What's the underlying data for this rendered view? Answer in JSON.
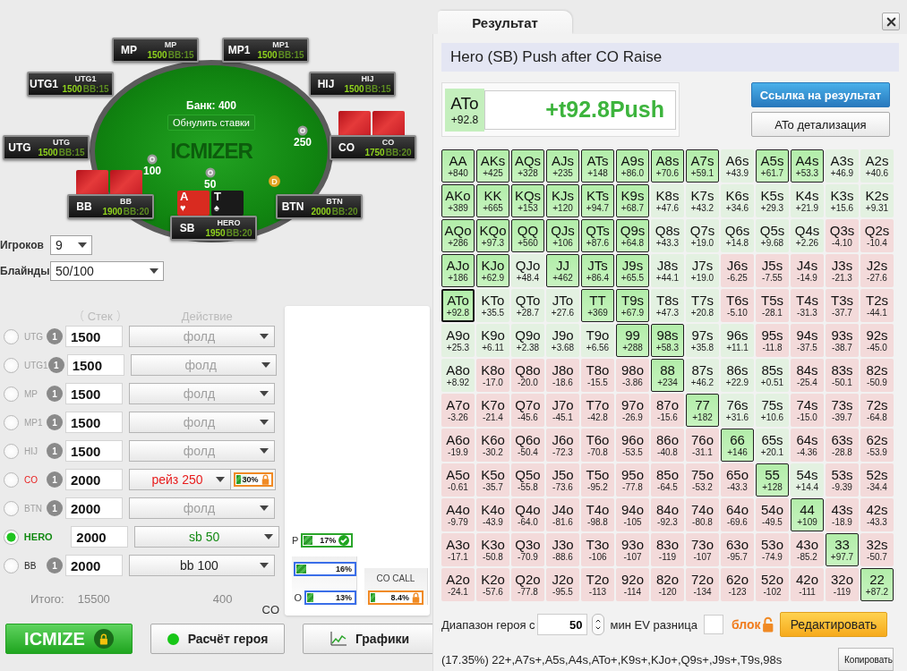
{
  "table": {
    "pot": "Банк: 400",
    "reset_button": "Обнулить ставки",
    "logo": "ICMIZER",
    "dealer": "D",
    "seats": [
      {
        "position": "MP",
        "name": "MP",
        "stack": "1500",
        "bb": "BB:15",
        "cards_face_down": false
      },
      {
        "position": "MP1",
        "name": "MP1",
        "stack": "1500",
        "bb": "BB:15",
        "cards_face_down": false
      },
      {
        "position": "UTG1",
        "name": "UTG1",
        "stack": "1500",
        "bb": "BB:15",
        "cards_face_down": false
      },
      {
        "position": "HIJ",
        "name": "HIJ",
        "stack": "1500",
        "bb": "BB:15",
        "cards_face_down": false
      },
      {
        "position": "UTG",
        "name": "UTG",
        "stack": "1500",
        "bb": "BB:15",
        "cards_face_down": false
      },
      {
        "position": "CO",
        "name": "CO",
        "stack": "1750",
        "bb": "BB:20",
        "cards_face_down": true
      },
      {
        "position": "BB",
        "name": "BB",
        "stack": "1900",
        "bb": "BB:20",
        "cards_face_down": true
      },
      {
        "position": "BTN",
        "name": "BTN",
        "stack": "2000",
        "bb": "BB:20",
        "cards_face_down": false
      },
      {
        "position": "SB",
        "name": "HERO",
        "stack": "1950",
        "bb": "BB:20",
        "cards_face_down": false
      }
    ],
    "hero_cards": [
      {
        "rank": "A",
        "suit": "♥",
        "color": "#d92b20"
      },
      {
        "rank": "T",
        "suit": "♠",
        "color": "#1a1a1a"
      }
    ],
    "bets": [
      {
        "amount": "250"
      },
      {
        "amount": "100"
      },
      {
        "amount": "50"
      }
    ]
  },
  "settings": {
    "players": {
      "label": "Игроков",
      "value": "9"
    },
    "blinds": {
      "label": "Блайнды",
      "value": "50/100"
    }
  },
  "players_table": {
    "headers": [
      "Стек",
      "Действие"
    ],
    "rows": [
      {
        "position": "UTG",
        "selected": false,
        "kind": "fold",
        "badge": "1",
        "stack": "1500",
        "action": "фолд"
      },
      {
        "position": "UTG1",
        "selected": false,
        "kind": "fold",
        "badge": "1",
        "stack": "1500",
        "action": "фолд"
      },
      {
        "position": "MP",
        "selected": false,
        "kind": "fold",
        "badge": "1",
        "stack": "1500",
        "action": "фолд"
      },
      {
        "position": "MP1",
        "selected": false,
        "kind": "fold",
        "badge": "1",
        "stack": "1500",
        "action": "фолд"
      },
      {
        "position": "HIJ",
        "selected": false,
        "kind": "fold",
        "badge": "1",
        "stack": "1500",
        "action": "фолд"
      },
      {
        "position": "CO",
        "selected": false,
        "kind": "raise",
        "badge": "1",
        "stack": "2000",
        "action": "рейз 250",
        "range": {
          "value": "30%",
          "level": 0.3,
          "locked": true
        }
      },
      {
        "position": "BTN",
        "selected": false,
        "kind": "fold",
        "badge": "1",
        "stack": "2000",
        "action": "фолд"
      },
      {
        "position": "HERO",
        "selected": true,
        "kind": "hero",
        "stack": "2000",
        "action": "sb 50"
      },
      {
        "position": "BB",
        "selected": false,
        "kind": "blind",
        "badge": "1",
        "stack": "2000",
        "action": "bb 100"
      }
    ],
    "totals": {
      "label": "Итого:",
      "stack": "15500",
      "action": "400"
    }
  },
  "range_panel": {
    "side_label": "CO",
    "ranges": [
      {
        "prefix": "P",
        "value": "17%",
        "level": 0.17,
        "kind": "confirmed"
      },
      {
        "value": "16%",
        "level": 0.16,
        "kind": "plain"
      },
      {
        "prefix": "O",
        "value": "13%",
        "level": 0.13,
        "kind": "plain"
      }
    ],
    "call": {
      "title": "CO CALL",
      "value": "8.4%",
      "level": 0.084,
      "locked": true
    }
  },
  "actions": [
    {
      "label": "ICMIZE",
      "kind": "primary",
      "locked": true
    },
    {
      "label": "Расчёт героя",
      "kind": "status"
    },
    {
      "label": "Графики",
      "kind": "chart"
    }
  ],
  "result": {
    "tab": "Результат",
    "title": "Hero (SB) Push after CO Raise",
    "hand": {
      "name": "ATo",
      "ev": "+92.8"
    },
    "verdict": "+t92.8Push",
    "buttons": [
      {
        "label": "Ссылка на результат",
        "kind": "primary"
      },
      {
        "label": "ATo детализация",
        "kind": "default"
      }
    ],
    "grid": [
      [
        {
          "hand": "AA",
          "ev": "+840",
          "in_range": true,
          "selected": false
        },
        {
          "hand": "AKs",
          "ev": "+425",
          "in_range": true,
          "selected": false
        },
        {
          "hand": "AQs",
          "ev": "+328",
          "in_range": true,
          "selected": false
        },
        {
          "hand": "AJs",
          "ev": "+235",
          "in_range": true,
          "selected": false
        },
        {
          "hand": "ATs",
          "ev": "+148",
          "in_range": true,
          "selected": false
        },
        {
          "hand": "A9s",
          "ev": "+86.0",
          "in_range": true,
          "selected": false
        },
        {
          "hand": "A8s",
          "ev": "+70.6",
          "in_range": true,
          "selected": false
        },
        {
          "hand": "A7s",
          "ev": "+59.1",
          "in_range": true,
          "selected": false
        },
        {
          "hand": "A6s",
          "ev": "+43.9",
          "in_range": false,
          "selected": false
        },
        {
          "hand": "A5s",
          "ev": "+61.7",
          "in_range": true,
          "selected": false
        },
        {
          "hand": "A4s",
          "ev": "+53.3",
          "in_range": true,
          "selected": false
        },
        {
          "hand": "A3s",
          "ev": "+46.9",
          "in_range": false,
          "selected": false
        },
        {
          "hand": "A2s",
          "ev": "+40.6",
          "in_range": false,
          "selected": false
        }
      ],
      [
        {
          "hand": "AKo",
          "ev": "+389",
          "in_range": true,
          "selected": false
        },
        {
          "hand": "KK",
          "ev": "+665",
          "in_range": true,
          "selected": false
        },
        {
          "hand": "KQs",
          "ev": "+153",
          "in_range": true,
          "selected": false
        },
        {
          "hand": "KJs",
          "ev": "+120",
          "in_range": true,
          "selected": false
        },
        {
          "hand": "KTs",
          "ev": "+94.7",
          "in_range": true,
          "selected": false
        },
        {
          "hand": "K9s",
          "ev": "+68.7",
          "in_range": true,
          "selected": false
        },
        {
          "hand": "K8s",
          "ev": "+47.6",
          "in_range": false,
          "selected": false
        },
        {
          "hand": "K7s",
          "ev": "+43.2",
          "in_range": false,
          "selected": false
        },
        {
          "hand": "K6s",
          "ev": "+34.6",
          "in_range": false,
          "selected": false
        },
        {
          "hand": "K5s",
          "ev": "+29.3",
          "in_range": false,
          "selected": false
        },
        {
          "hand": "K4s",
          "ev": "+21.9",
          "in_range": false,
          "selected": false
        },
        {
          "hand": "K3s",
          "ev": "+15.6",
          "in_range": false,
          "selected": false
        },
        {
          "hand": "K2s",
          "ev": "+9.31",
          "in_range": false,
          "selected": false
        }
      ],
      [
        {
          "hand": "AQo",
          "ev": "+286",
          "in_range": true,
          "selected": false
        },
        {
          "hand": "KQo",
          "ev": "+97.3",
          "in_range": true,
          "selected": false
        },
        {
          "hand": "QQ",
          "ev": "+560",
          "in_range": true,
          "selected": false
        },
        {
          "hand": "QJs",
          "ev": "+106",
          "in_range": true,
          "selected": false
        },
        {
          "hand": "QTs",
          "ev": "+87.6",
          "in_range": true,
          "selected": false
        },
        {
          "hand": "Q9s",
          "ev": "+64.8",
          "in_range": true,
          "selected": false
        },
        {
          "hand": "Q8s",
          "ev": "+43.3",
          "in_range": false,
          "selected": false
        },
        {
          "hand": "Q7s",
          "ev": "+19.0",
          "in_range": false,
          "selected": false
        },
        {
          "hand": "Q6s",
          "ev": "+14.8",
          "in_range": false,
          "selected": false
        },
        {
          "hand": "Q5s",
          "ev": "+9.68",
          "in_range": false,
          "selected": false
        },
        {
          "hand": "Q4s",
          "ev": "+2.26",
          "in_range": false,
          "selected": false
        },
        {
          "hand": "Q3s",
          "ev": "-4.10",
          "in_range": false,
          "selected": false
        },
        {
          "hand": "Q2s",
          "ev": "-10.4",
          "in_range": false,
          "selected": false
        }
      ],
      [
        {
          "hand": "AJo",
          "ev": "+186",
          "in_range": true,
          "selected": false
        },
        {
          "hand": "KJo",
          "ev": "+62.9",
          "in_range": true,
          "selected": false
        },
        {
          "hand": "QJo",
          "ev": "+48.4",
          "in_range": false,
          "selected": false
        },
        {
          "hand": "JJ",
          "ev": "+462",
          "in_range": true,
          "selected": false
        },
        {
          "hand": "JTs",
          "ev": "+86.4",
          "in_range": true,
          "selected": false
        },
        {
          "hand": "J9s",
          "ev": "+65.5",
          "in_range": true,
          "selected": false
        },
        {
          "hand": "J8s",
          "ev": "+44.1",
          "in_range": false,
          "selected": false
        },
        {
          "hand": "J7s",
          "ev": "+19.0",
          "in_range": false,
          "selected": false
        },
        {
          "hand": "J6s",
          "ev": "-6.25",
          "in_range": false,
          "selected": false
        },
        {
          "hand": "J5s",
          "ev": "-7.55",
          "in_range": false,
          "selected": false
        },
        {
          "hand": "J4s",
          "ev": "-14.9",
          "in_range": false,
          "selected": false
        },
        {
          "hand": "J3s",
          "ev": "-21.3",
          "in_range": false,
          "selected": false
        },
        {
          "hand": "J2s",
          "ev": "-27.6",
          "in_range": false,
          "selected": false
        }
      ],
      [
        {
          "hand": "ATo",
          "ev": "+92.8",
          "in_range": true,
          "selected": true
        },
        {
          "hand": "KTo",
          "ev": "+35.5",
          "in_range": false,
          "selected": false
        },
        {
          "hand": "QTo",
          "ev": "+28.7",
          "in_range": false,
          "selected": false
        },
        {
          "hand": "JTo",
          "ev": "+27.6",
          "in_range": false,
          "selected": false
        },
        {
          "hand": "TT",
          "ev": "+369",
          "in_range": true,
          "selected": false
        },
        {
          "hand": "T9s",
          "ev": "+67.9",
          "in_range": true,
          "selected": false
        },
        {
          "hand": "T8s",
          "ev": "+47.3",
          "in_range": false,
          "selected": false
        },
        {
          "hand": "T7s",
          "ev": "+20.8",
          "in_range": false,
          "selected": false
        },
        {
          "hand": "T6s",
          "ev": "-5.10",
          "in_range": false,
          "selected": false
        },
        {
          "hand": "T5s",
          "ev": "-28.1",
          "in_range": false,
          "selected": false
        },
        {
          "hand": "T4s",
          "ev": "-31.3",
          "in_range": false,
          "selected": false
        },
        {
          "hand": "T3s",
          "ev": "-37.7",
          "in_range": false,
          "selected": false
        },
        {
          "hand": "T2s",
          "ev": "-44.1",
          "in_range": false,
          "selected": false
        }
      ],
      [
        {
          "hand": "A9o",
          "ev": "+25.3",
          "in_range": false,
          "selected": false
        },
        {
          "hand": "K9o",
          "ev": "+6.11",
          "in_range": false,
          "selected": false
        },
        {
          "hand": "Q9o",
          "ev": "+2.38",
          "in_range": false,
          "selected": false
        },
        {
          "hand": "J9o",
          "ev": "+3.68",
          "in_range": false,
          "selected": false
        },
        {
          "hand": "T9o",
          "ev": "+6.56",
          "in_range": false,
          "selected": false
        },
        {
          "hand": "99",
          "ev": "+288",
          "in_range": true,
          "selected": false
        },
        {
          "hand": "98s",
          "ev": "+58.3",
          "in_range": true,
          "selected": false
        },
        {
          "hand": "97s",
          "ev": "+35.8",
          "in_range": false,
          "selected": false
        },
        {
          "hand": "96s",
          "ev": "+11.1",
          "in_range": false,
          "selected": false
        },
        {
          "hand": "95s",
          "ev": "-11.8",
          "in_range": false,
          "selected": false
        },
        {
          "hand": "94s",
          "ev": "-37.5",
          "in_range": false,
          "selected": false
        },
        {
          "hand": "93s",
          "ev": "-38.7",
          "in_range": false,
          "selected": false
        },
        {
          "hand": "92s",
          "ev": "-45.0",
          "in_range": false,
          "selected": false
        }
      ],
      [
        {
          "hand": "A8o",
          "ev": "+8.92",
          "in_range": false,
          "selected": false
        },
        {
          "hand": "K8o",
          "ev": "-17.0",
          "in_range": false,
          "selected": false
        },
        {
          "hand": "Q8o",
          "ev": "-20.0",
          "in_range": false,
          "selected": false
        },
        {
          "hand": "J8o",
          "ev": "-18.6",
          "in_range": false,
          "selected": false
        },
        {
          "hand": "T8o",
          "ev": "-15.5",
          "in_range": false,
          "selected": false
        },
        {
          "hand": "98o",
          "ev": "-3.86",
          "in_range": false,
          "selected": false
        },
        {
          "hand": "88",
          "ev": "+234",
          "in_range": true,
          "selected": false
        },
        {
          "hand": "87s",
          "ev": "+46.2",
          "in_range": false,
          "selected": false
        },
        {
          "hand": "86s",
          "ev": "+22.9",
          "in_range": false,
          "selected": false
        },
        {
          "hand": "85s",
          "ev": "+0.51",
          "in_range": false,
          "selected": false
        },
        {
          "hand": "84s",
          "ev": "-25.4",
          "in_range": false,
          "selected": false
        },
        {
          "hand": "83s",
          "ev": "-50.1",
          "in_range": false,
          "selected": false
        },
        {
          "hand": "82s",
          "ev": "-50.9",
          "in_range": false,
          "selected": false
        }
      ],
      [
        {
          "hand": "A7o",
          "ev": "-3.26",
          "in_range": false,
          "selected": false
        },
        {
          "hand": "K7o",
          "ev": "-21.4",
          "in_range": false,
          "selected": false
        },
        {
          "hand": "Q7o",
          "ev": "-45.6",
          "in_range": false,
          "selected": false
        },
        {
          "hand": "J7o",
          "ev": "-45.1",
          "in_range": false,
          "selected": false
        },
        {
          "hand": "T7o",
          "ev": "-42.8",
          "in_range": false,
          "selected": false
        },
        {
          "hand": "97o",
          "ev": "-26.9",
          "in_range": false,
          "selected": false
        },
        {
          "hand": "87o",
          "ev": "-15.6",
          "in_range": false,
          "selected": false
        },
        {
          "hand": "77",
          "ev": "+182",
          "in_range": true,
          "selected": false
        },
        {
          "hand": "76s",
          "ev": "+31.6",
          "in_range": false,
          "selected": false
        },
        {
          "hand": "75s",
          "ev": "+10.6",
          "in_range": false,
          "selected": false
        },
        {
          "hand": "74s",
          "ev": "-15.0",
          "in_range": false,
          "selected": false
        },
        {
          "hand": "73s",
          "ev": "-39.7",
          "in_range": false,
          "selected": false
        },
        {
          "hand": "72s",
          "ev": "-64.8",
          "in_range": false,
          "selected": false
        }
      ],
      [
        {
          "hand": "A6o",
          "ev": "-19.9",
          "in_range": false,
          "selected": false
        },
        {
          "hand": "K6o",
          "ev": "-30.2",
          "in_range": false,
          "selected": false
        },
        {
          "hand": "Q6o",
          "ev": "-50.4",
          "in_range": false,
          "selected": false
        },
        {
          "hand": "J6o",
          "ev": "-72.3",
          "in_range": false,
          "selected": false
        },
        {
          "hand": "T6o",
          "ev": "-70.8",
          "in_range": false,
          "selected": false
        },
        {
          "hand": "96o",
          "ev": "-53.5",
          "in_range": false,
          "selected": false
        },
        {
          "hand": "86o",
          "ev": "-40.8",
          "in_range": false,
          "selected": false
        },
        {
          "hand": "76o",
          "ev": "-31.1",
          "in_range": false,
          "selected": false
        },
        {
          "hand": "66",
          "ev": "+146",
          "in_range": true,
          "selected": false
        },
        {
          "hand": "65s",
          "ev": "+20.1",
          "in_range": false,
          "selected": false
        },
        {
          "hand": "64s",
          "ev": "-4.36",
          "in_range": false,
          "selected": false
        },
        {
          "hand": "63s",
          "ev": "-28.8",
          "in_range": false,
          "selected": false
        },
        {
          "hand": "62s",
          "ev": "-53.9",
          "in_range": false,
          "selected": false
        }
      ],
      [
        {
          "hand": "A5o",
          "ev": "-0.61",
          "in_range": false,
          "selected": false
        },
        {
          "hand": "K5o",
          "ev": "-35.7",
          "in_range": false,
          "selected": false
        },
        {
          "hand": "Q5o",
          "ev": "-55.8",
          "in_range": false,
          "selected": false
        },
        {
          "hand": "J5o",
          "ev": "-73.6",
          "in_range": false,
          "selected": false
        },
        {
          "hand": "T5o",
          "ev": "-95.2",
          "in_range": false,
          "selected": false
        },
        {
          "hand": "95o",
          "ev": "-77.8",
          "in_range": false,
          "selected": false
        },
        {
          "hand": "85o",
          "ev": "-64.5",
          "in_range": false,
          "selected": false
        },
        {
          "hand": "75o",
          "ev": "-53.2",
          "in_range": false,
          "selected": false
        },
        {
          "hand": "65o",
          "ev": "-43.3",
          "in_range": false,
          "selected": false
        },
        {
          "hand": "55",
          "ev": "+128",
          "in_range": true,
          "selected": false
        },
        {
          "hand": "54s",
          "ev": "+14.4",
          "in_range": false,
          "selected": false
        },
        {
          "hand": "53s",
          "ev": "-9.39",
          "in_range": false,
          "selected": false
        },
        {
          "hand": "52s",
          "ev": "-34.4",
          "in_range": false,
          "selected": false
        }
      ],
      [
        {
          "hand": "A4o",
          "ev": "-9.79",
          "in_range": false,
          "selected": false
        },
        {
          "hand": "K4o",
          "ev": "-43.9",
          "in_range": false,
          "selected": false
        },
        {
          "hand": "Q4o",
          "ev": "-64.0",
          "in_range": false,
          "selected": false
        },
        {
          "hand": "J4o",
          "ev": "-81.6",
          "in_range": false,
          "selected": false
        },
        {
          "hand": "T4o",
          "ev": "-98.8",
          "in_range": false,
          "selected": false
        },
        {
          "hand": "94o",
          "ev": "-105",
          "in_range": false,
          "selected": false
        },
        {
          "hand": "84o",
          "ev": "-92.3",
          "in_range": false,
          "selected": false
        },
        {
          "hand": "74o",
          "ev": "-80.8",
          "in_range": false,
          "selected": false
        },
        {
          "hand": "64o",
          "ev": "-69.6",
          "in_range": false,
          "selected": false
        },
        {
          "hand": "54o",
          "ev": "-49.5",
          "in_range": false,
          "selected": false
        },
        {
          "hand": "44",
          "ev": "+109",
          "in_range": true,
          "selected": false
        },
        {
          "hand": "43s",
          "ev": "-18.9",
          "in_range": false,
          "selected": false
        },
        {
          "hand": "42s",
          "ev": "-43.3",
          "in_range": false,
          "selected": false
        }
      ],
      [
        {
          "hand": "A3o",
          "ev": "-17.1",
          "in_range": false,
          "selected": false
        },
        {
          "hand": "K3o",
          "ev": "-50.8",
          "in_range": false,
          "selected": false
        },
        {
          "hand": "Q3o",
          "ev": "-70.9",
          "in_range": false,
          "selected": false
        },
        {
          "hand": "J3o",
          "ev": "-88.6",
          "in_range": false,
          "selected": false
        },
        {
          "hand": "T3o",
          "ev": "-106",
          "in_range": false,
          "selected": false
        },
        {
          "hand": "93o",
          "ev": "-107",
          "in_range": false,
          "selected": false
        },
        {
          "hand": "83o",
          "ev": "-119",
          "in_range": false,
          "selected": false
        },
        {
          "hand": "73o",
          "ev": "-107",
          "in_range": false,
          "selected": false
        },
        {
          "hand": "63o",
          "ev": "-95.7",
          "in_range": false,
          "selected": false
        },
        {
          "hand": "53o",
          "ev": "-74.9",
          "in_range": false,
          "selected": false
        },
        {
          "hand": "43o",
          "ev": "-85.2",
          "in_range": false,
          "selected": false
        },
        {
          "hand": "33",
          "ev": "+97.7",
          "in_range": true,
          "selected": false
        },
        {
          "hand": "32s",
          "ev": "-50.7",
          "in_range": false,
          "selected": false
        }
      ],
      [
        {
          "hand": "A2o",
          "ev": "-24.1",
          "in_range": false,
          "selected": false
        },
        {
          "hand": "K2o",
          "ev": "-57.6",
          "in_range": false,
          "selected": false
        },
        {
          "hand": "Q2o",
          "ev": "-77.8",
          "in_range": false,
          "selected": false
        },
        {
          "hand": "J2o",
          "ev": "-95.5",
          "in_range": false,
          "selected": false
        },
        {
          "hand": "T2o",
          "ev": "-113",
          "in_range": false,
          "selected": false
        },
        {
          "hand": "92o",
          "ev": "-114",
          "in_range": false,
          "selected": false
        },
        {
          "hand": "82o",
          "ev": "-120",
          "in_range": false,
          "selected": false
        },
        {
          "hand": "72o",
          "ev": "-134",
          "in_range": false,
          "selected": false
        },
        {
          "hand": "62o",
          "ev": "-123",
          "in_range": false,
          "selected": false
        },
        {
          "hand": "52o",
          "ev": "-102",
          "in_range": false,
          "selected": false
        },
        {
          "hand": "42o",
          "ev": "-111",
          "in_range": false,
          "selected": false
        },
        {
          "hand": "32o",
          "ev": "-119",
          "in_range": false,
          "selected": false
        },
        {
          "hand": "22",
          "ev": "+87.2",
          "in_range": true,
          "selected": false
        }
      ]
    ],
    "filter": {
      "label": "Диапазон героя с",
      "value": "50",
      "ev_label": "мин EV разница",
      "lock_label": "блок",
      "locked": false
    },
    "edit_button": "Редактировать",
    "range_text": "(17.35%) 22+,A7s+,A5s,A4s,ATo+,K9s+,KJo+,Q9s+,J9s+,T9s,98s",
    "copy_button": "Копировать"
  }
}
